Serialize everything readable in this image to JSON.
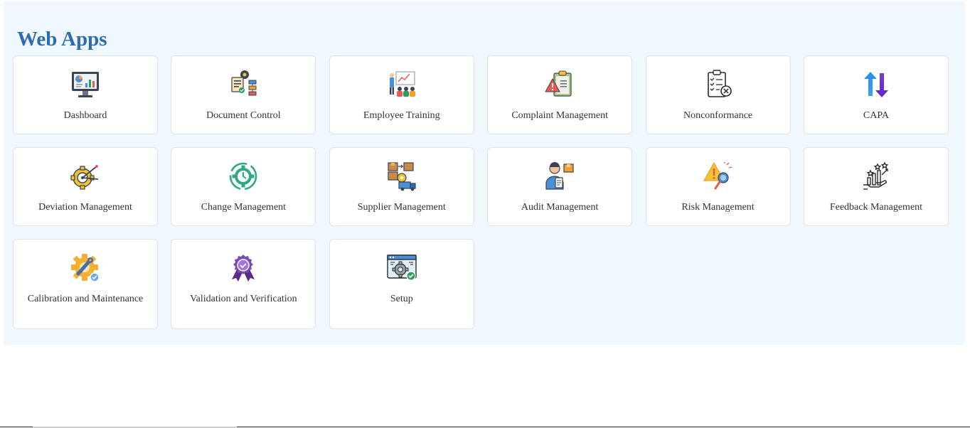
{
  "page": {
    "title": "Web Apps"
  },
  "apps": [
    {
      "label": "Dashboard",
      "icon": "dashboard-monitor-icon"
    },
    {
      "label": "Document Control",
      "icon": "document-workflow-icon"
    },
    {
      "label": "Employee Training",
      "icon": "training-presentation-icon"
    },
    {
      "label": "Complaint Management",
      "icon": "complaint-clipboard-warning-icon"
    },
    {
      "label": "Nonconformance",
      "icon": "checklist-reject-icon"
    },
    {
      "label": "CAPA",
      "icon": "up-down-arrows-icon"
    },
    {
      "label": "Deviation Management",
      "icon": "gear-compass-icon"
    },
    {
      "label": "Change Management",
      "icon": "gear-clock-cycle-icon"
    },
    {
      "label": "Supplier Management",
      "icon": "supplier-truck-boxes-icon"
    },
    {
      "label": "Audit Management",
      "icon": "auditor-clipboard-icon"
    },
    {
      "label": "Risk Management",
      "icon": "risk-warning-magnifier-icon"
    },
    {
      "label": "Feedback Management",
      "icon": "hand-rating-stars-icon"
    },
    {
      "label": "Calibration and Maintenance",
      "icon": "gear-wrench-check-icon"
    },
    {
      "label": "Validation and Verification",
      "icon": "award-ribbon-check-icon"
    },
    {
      "label": "Setup",
      "icon": "browser-gear-check-icon"
    }
  ],
  "colors": {
    "title": "#2c6cb0",
    "panel_background": "#f0f7fe",
    "card_border": "#dde2e7"
  }
}
